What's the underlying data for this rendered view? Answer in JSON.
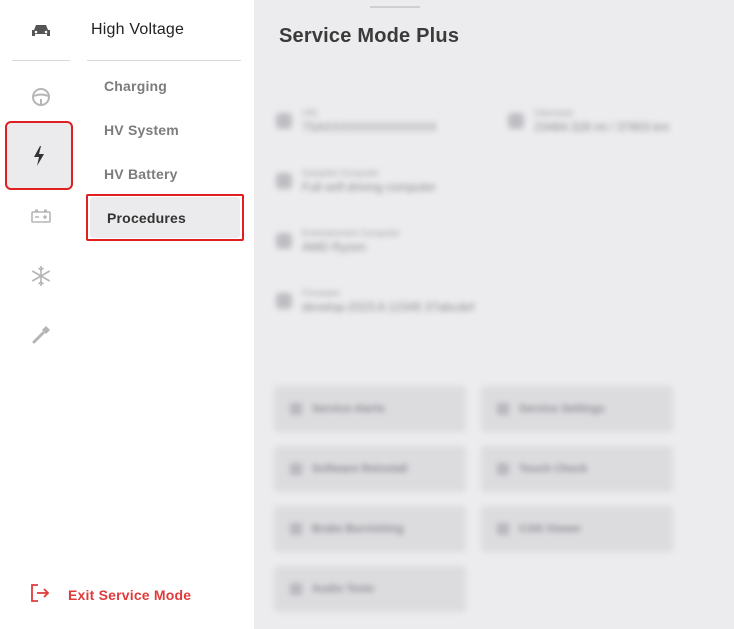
{
  "rail": {
    "items": [
      {
        "icon": "car-icon"
      },
      {
        "icon": "steering-wheel-icon"
      },
      {
        "icon": "lightning-bolt-icon",
        "active": true
      },
      {
        "icon": "battery-icon"
      },
      {
        "icon": "snowflake-icon"
      },
      {
        "icon": "wrench-icon"
      }
    ]
  },
  "submenu": {
    "title": "High Voltage",
    "items": [
      "Charging",
      "HV System",
      "HV Battery",
      "Procedures"
    ],
    "active_index": 3
  },
  "exit": {
    "label": "Exit Service Mode"
  },
  "main": {
    "title": "Service Mode Plus",
    "info": [
      {
        "label": "VIN",
        "value": "7SAXXXXXXXXXXXXXX"
      },
      {
        "label": "Odometer",
        "value": "23484.328 mi / 37803 km"
      },
      {
        "label": "Autopilot Computer",
        "value": "Full self-driving computer"
      },
      {
        "label": "Entertainment Computer",
        "value": "AMD Ryzen"
      },
      {
        "label": "Firmware",
        "value": "develop-2023.8.12345 37abcdef"
      }
    ],
    "tiles": [
      "Service Alerts",
      "Service Settings",
      "Software Reinstall",
      "Touch Check",
      "Brake Burnishing",
      "CAN Viewer",
      "Audio Tests"
    ]
  },
  "colors": {
    "highlight": "#e02020",
    "exit": "#e03a3a"
  }
}
